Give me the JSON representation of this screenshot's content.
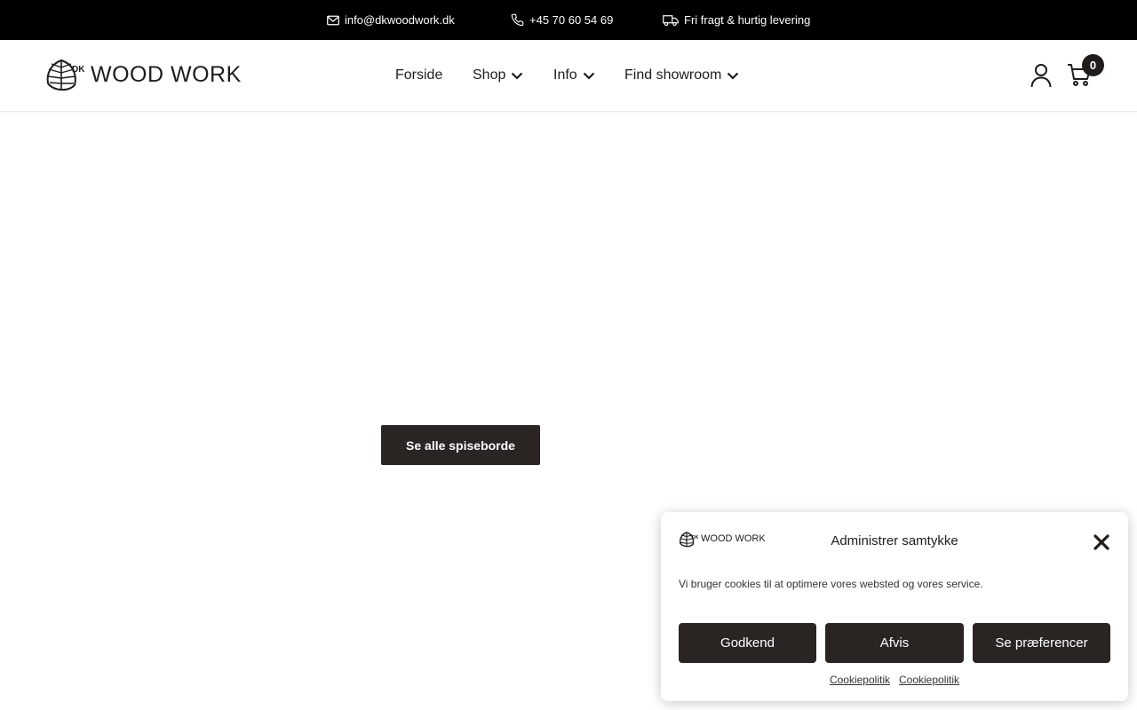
{
  "topbar": {
    "email": "info@dkwoodwork.dk",
    "phone": "+45 70 60 54 69",
    "shipping": "Fri fragt & hurtig levering"
  },
  "header": {
    "logo_prefix": "DK",
    "logo_text": "WOOD WORK",
    "nav": {
      "forside": "Forside",
      "shop": "Shop",
      "info": "Info",
      "showroom": "Find showroom"
    },
    "cart_count": "0"
  },
  "hero": {
    "cta_label": "Se alle spiseborde"
  },
  "cookie": {
    "logo_prefix": "DK",
    "logo_text": "WOOD WORK",
    "title": "Administrer samtykke",
    "message": "Vi bruger cookies til at optimere vores websted og vores service.",
    "accept_label": "Godkend",
    "deny_label": "Afvis",
    "prefs_label": "Se præferencer",
    "link_1": "Cookiepolitik",
    "link_2": "Cookiepolitik"
  },
  "colors": {
    "topbar_bg": "#000000",
    "button_bg": "#2a2522",
    "text": "#1f1c1a"
  }
}
